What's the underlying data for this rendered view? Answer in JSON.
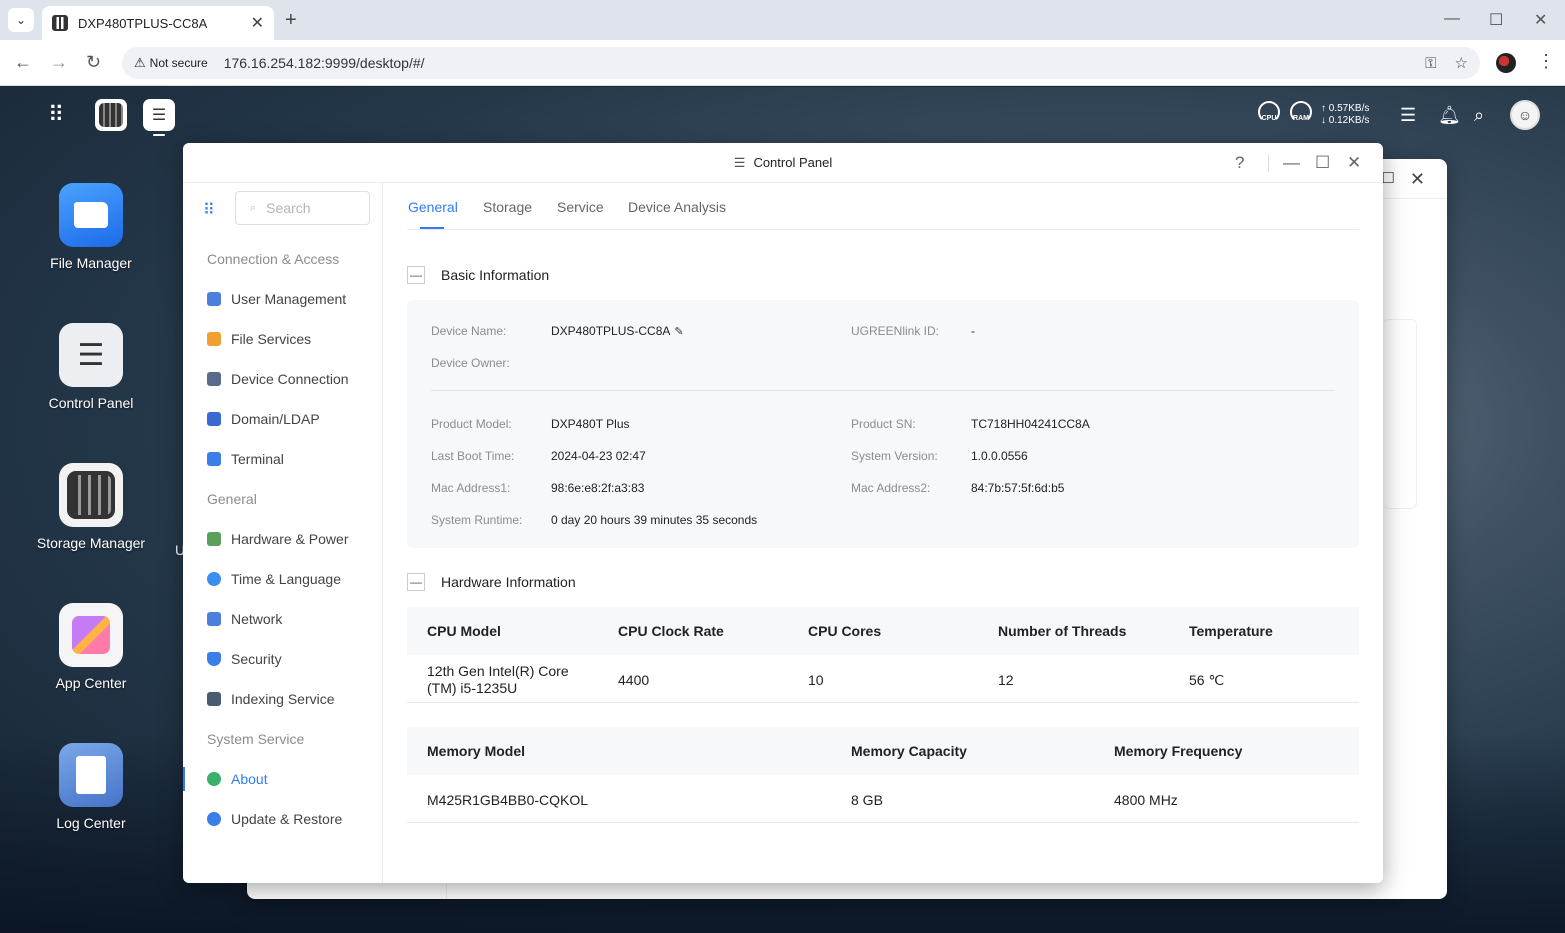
{
  "browser": {
    "tab_title": "DXP480TPLUS-CC8A",
    "security_label": "Not secure",
    "url": "176.16.254.182:9999/desktop/#/"
  },
  "desktop": {
    "status": {
      "cpu_label": "CPU",
      "ram_label": "RAM",
      "upload": "↑ 0.57KB/s",
      "download": "↓ 0.12KB/s"
    },
    "icons": [
      {
        "label": "File Manager"
      },
      {
        "label": "Control Panel"
      },
      {
        "label": "Storage Manager"
      },
      {
        "label": "App Center"
      },
      {
        "label": "Log Center"
      }
    ],
    "partial_label": "U"
  },
  "control_panel": {
    "title": "Control Panel",
    "help": "?",
    "search_placeholder": "Search",
    "sidebar": {
      "groups": [
        "Connection & Access",
        "General",
        "System Service"
      ],
      "items": [
        {
          "label": "User Management",
          "color": "#4a7fe0"
        },
        {
          "label": "File Services",
          "color": "#f0a030"
        },
        {
          "label": "Device Connection",
          "color": "#5a6a8a"
        },
        {
          "label": "Domain/LDAP",
          "color": "#3a6ad0"
        },
        {
          "label": "Terminal",
          "color": "#3a7ee8"
        },
        {
          "label": "Hardware & Power",
          "color": "#5aa05a"
        },
        {
          "label": "Time & Language",
          "color": "#3a8ef0"
        },
        {
          "label": "Network",
          "color": "#4a7fe0"
        },
        {
          "label": "Security",
          "color": "#3a7ee8"
        },
        {
          "label": "Indexing Service",
          "color": "#4a5a70"
        },
        {
          "label": "About",
          "color": "#3ab06a"
        },
        {
          "label": "Update & Restore",
          "color": "#3a7ee8"
        }
      ]
    },
    "tabs": [
      "General",
      "Storage",
      "Service",
      "Device Analysis"
    ],
    "basic_info": {
      "heading": "Basic Information",
      "device_name_label": "Device Name:",
      "device_name": "DXP480TPLUS-CC8A",
      "ugreenlink_label": "UGREENlink ID:",
      "ugreenlink": "-",
      "owner_label": "Device Owner:",
      "product_model_label": "Product Model:",
      "product_model": "DXP480T Plus",
      "product_sn_label": "Product SN:",
      "product_sn": "TC718HH04241CC8A",
      "boot_label": "Last Boot Time:",
      "boot": "2024-04-23 02:47",
      "sysver_label": "System Version:",
      "sysver": "1.0.0.0556",
      "mac1_label": "Mac Address1:",
      "mac1": "98:6e:e8:2f:a3:83",
      "mac2_label": "Mac Address2:",
      "mac2": "84:7b:57:5f:6d:b5",
      "runtime_label": "System Runtime:",
      "runtime": "0 day 20 hours 39 minutes 35 seconds"
    },
    "hardware_info": {
      "heading": "Hardware Information",
      "cpu_headers": [
        "CPU Model",
        "CPU Clock Rate",
        "CPU Cores",
        "Number of Threads",
        "Temperature"
      ],
      "cpu_row": [
        "12th Gen Intel(R) Core (TM) i5-1235U",
        "4400",
        "10",
        "12",
        "56 ℃"
      ],
      "mem_headers": [
        "Memory Model",
        "Memory Capacity",
        "Memory Frequency"
      ],
      "mem_row": [
        "M425R1GB4BB0-CQKOL",
        "8 GB",
        "4800 MHz"
      ]
    }
  }
}
